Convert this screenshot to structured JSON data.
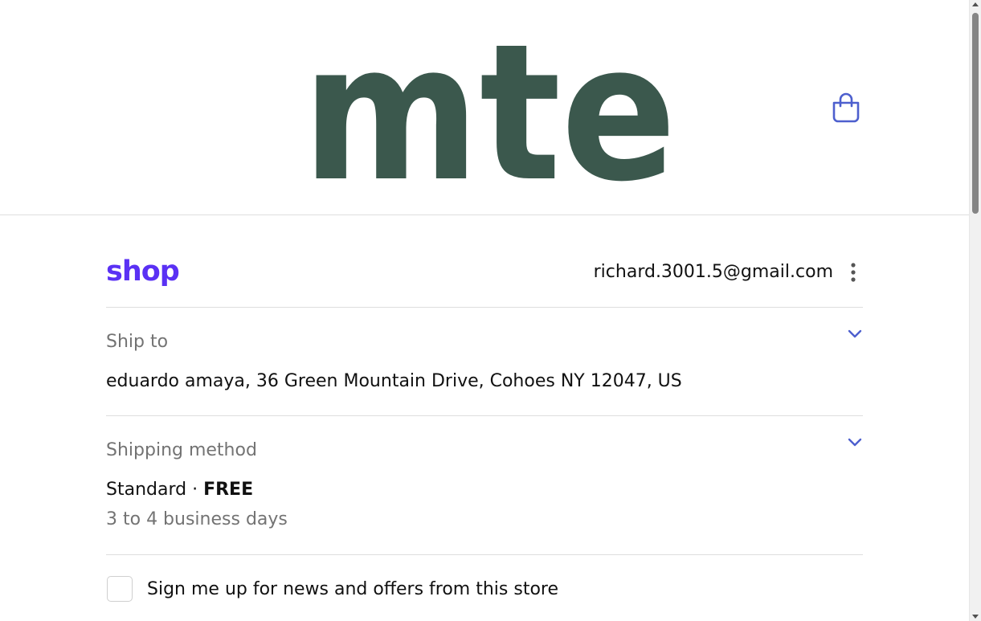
{
  "header": {
    "logo_text": "mte",
    "cart_icon": "shopping-bag-icon"
  },
  "account": {
    "shop_logo": "shop",
    "email": "richard.3001.5@gmail.com",
    "menu_icon": "more-vertical-icon"
  },
  "ship_to": {
    "label": "Ship to",
    "value": "eduardo amaya, 36 Green Mountain Drive, Cohoes NY 12047, US",
    "toggle_icon": "chevron-down-icon"
  },
  "shipping_method": {
    "label": "Shipping method",
    "name": "Standard",
    "separator": " · ",
    "price": "FREE",
    "delivery_time": "3 to 4 business days",
    "toggle_icon": "chevron-down-icon"
  },
  "newsletter": {
    "label": "Sign me up for news and offers from this store",
    "checked": false
  },
  "colors": {
    "logo_green": "#3b584d",
    "shop_purple": "#5a31f4",
    "accent_blue": "#4d5fce",
    "muted_text": "#737373",
    "divider": "#dedede"
  }
}
